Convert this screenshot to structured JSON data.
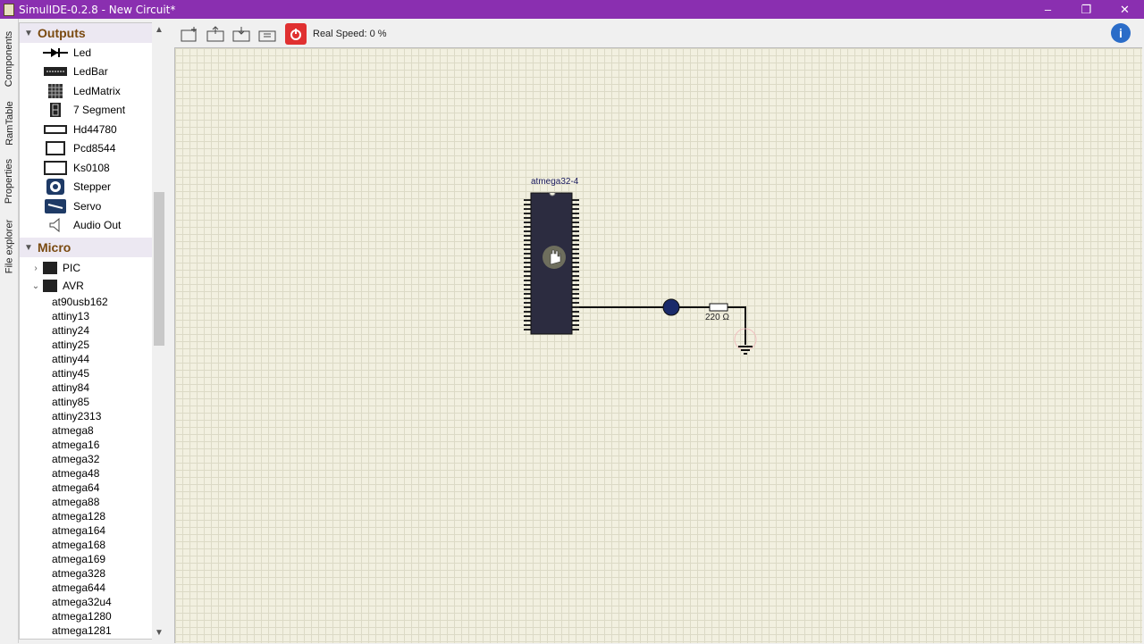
{
  "window": {
    "title": "SimulIDE-0.2.8 - New Circuit*",
    "minimize": "–",
    "maximize": "❐",
    "close": "✕"
  },
  "side_tabs": [
    "Components",
    "RamTable",
    "Properties",
    "File explorer"
  ],
  "outputs": {
    "label": "Outputs",
    "items": [
      {
        "label": "Led",
        "icon": "led-icon"
      },
      {
        "label": "LedBar",
        "icon": "ledbar-icon"
      },
      {
        "label": "LedMatrix",
        "icon": "ledmatrix-icon"
      },
      {
        "label": "7 Segment",
        "icon": "seven-segment-icon"
      },
      {
        "label": "Hd44780",
        "icon": "lcd-icon"
      },
      {
        "label": "Pcd8544",
        "icon": "lcd-icon"
      },
      {
        "label": "Ks0108",
        "icon": "lcd-icon"
      },
      {
        "label": "Stepper",
        "icon": "stepper-icon"
      },
      {
        "label": "Servo",
        "icon": "servo-icon"
      },
      {
        "label": "Audio Out",
        "icon": "speaker-icon"
      }
    ]
  },
  "micro": {
    "label": "Micro",
    "pic": "PIC",
    "avr": "AVR",
    "avr_items": [
      "at90usb162",
      "attiny13",
      "attiny24",
      "attiny25",
      "attiny44",
      "attiny45",
      "attiny84",
      "attiny85",
      "attiny2313",
      "atmega8",
      "atmega16",
      "atmega32",
      "atmega48",
      "atmega64",
      "atmega88",
      "atmega128",
      "atmega164",
      "atmega168",
      "atmega169",
      "atmega328",
      "atmega644",
      "atmega32u4",
      "atmega1280",
      "atmega1281"
    ]
  },
  "toolbar": {
    "speed": "Real Speed: 0 %"
  },
  "circuit": {
    "chip_label": "atmega32-4",
    "resistor_label": "220 Ω"
  },
  "colors": {
    "titlebar": "#8a2fb0",
    "category_text": "#7a4a10",
    "canvas": "#f2f0e0",
    "power_button": "#e03030"
  }
}
